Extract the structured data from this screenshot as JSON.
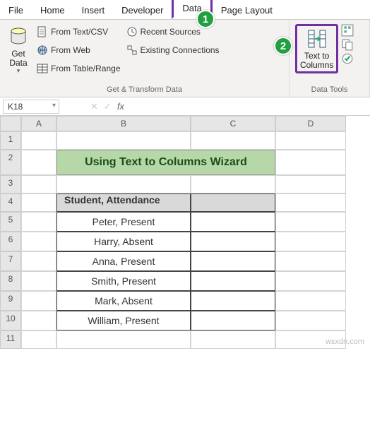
{
  "tabs": {
    "file": "File",
    "home": "Home",
    "insert": "Insert",
    "developer": "Developer",
    "data": "Data",
    "pagelayout": "Page Layout"
  },
  "ribbon": {
    "getdata": {
      "label": "Get\nData",
      "group": "Get & Transform Data",
      "fromtextcsv": "From Text/CSV",
      "fromweb": "From Web",
      "fromtable": "From Table/Range",
      "recentsources": "Recent Sources",
      "existingconn": "Existing Connections"
    },
    "texttocol": {
      "line1": "Text to",
      "line2": "Columns"
    },
    "datatools": "Data Tools"
  },
  "callouts": {
    "c1": "1",
    "c2": "2"
  },
  "namebox": "K18",
  "fx": "fx",
  "cols": {
    "a": "A",
    "b": "B",
    "c": "C",
    "d": "D"
  },
  "rownums": [
    "1",
    "2",
    "3",
    "4",
    "5",
    "6",
    "7",
    "8",
    "9",
    "10",
    "11"
  ],
  "title": "Using Text to Columns Wizard",
  "table": {
    "header": "Student, Attendance",
    "rows": [
      "Peter, Present",
      "Harry, Absent",
      "Anna, Present",
      "Smith, Present",
      "Mark, Absent",
      "William, Present"
    ]
  },
  "watermark": "wsxdn.com"
}
